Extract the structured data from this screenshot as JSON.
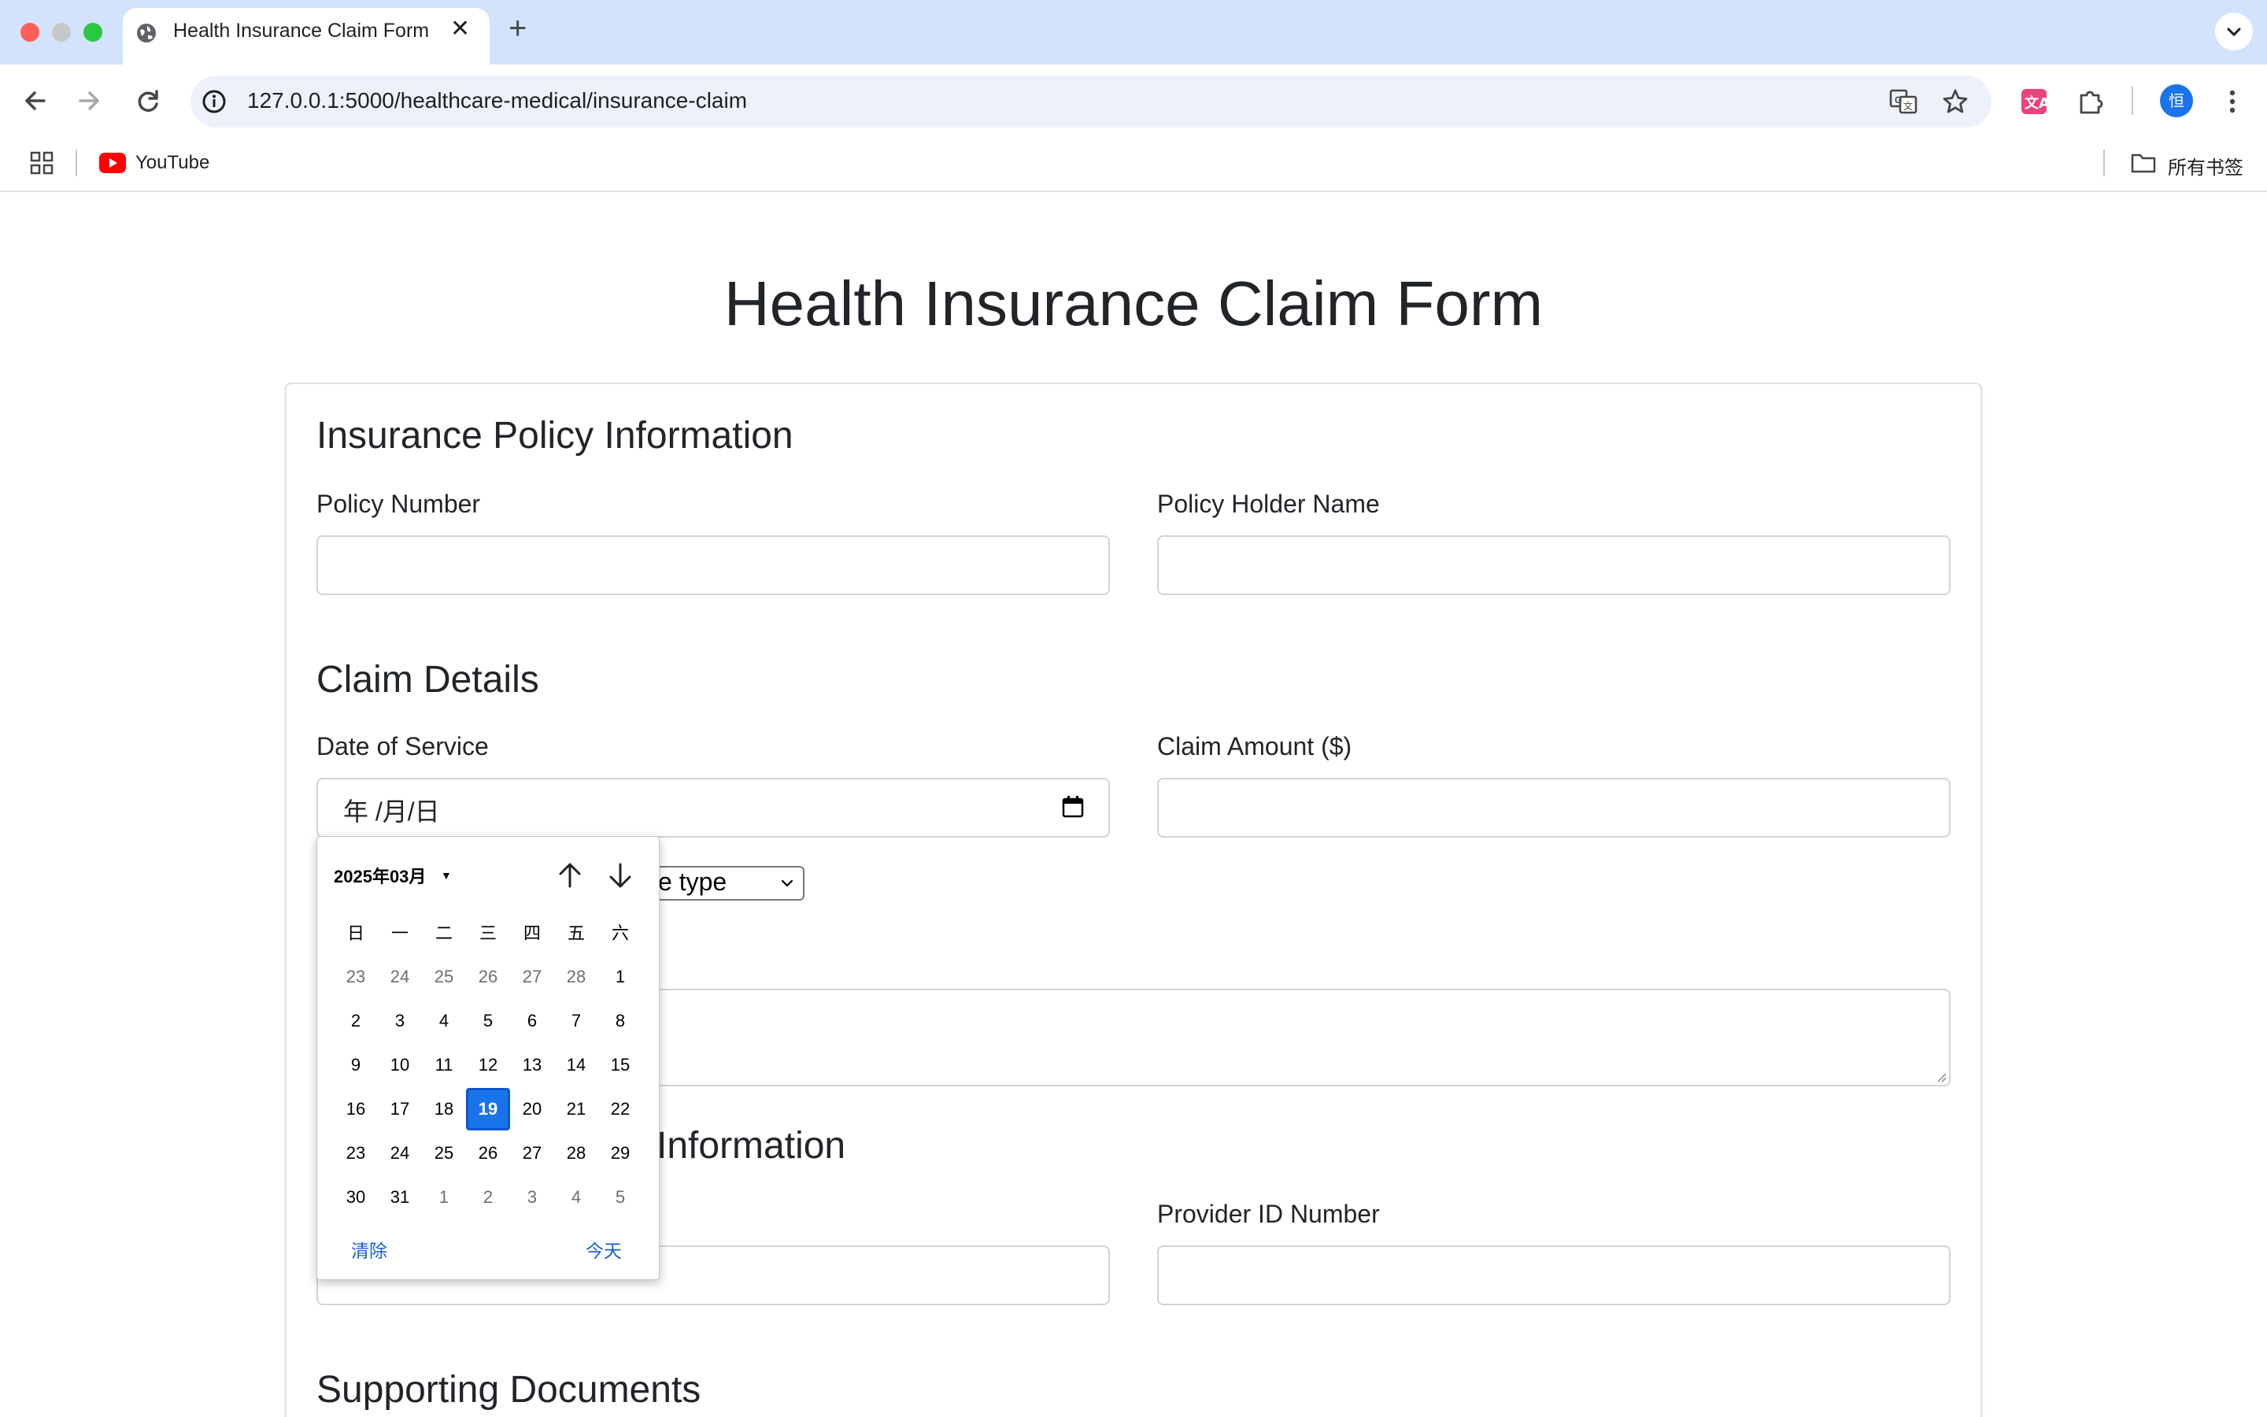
{
  "browser": {
    "tab_title": "Health Insurance Claim Form",
    "url": "127.0.0.1:5000/healthcare-medical/insurance-claim",
    "bookmark_youtube": "YouTube",
    "bookmark_folder": "所有书签",
    "profile_initial": "恒"
  },
  "page": {
    "title": "Health Insurance Claim Form"
  },
  "policy": {
    "heading": "Insurance Policy Information",
    "policy_number_label": "Policy Number",
    "policy_number_value": "",
    "holder_name_label": "Policy Holder Name",
    "holder_name_value": ""
  },
  "claim": {
    "heading": "Claim Details",
    "date_label": "Date of Service",
    "date_value": "年 /月/日",
    "amount_label": "Claim Amount ($)",
    "amount_value": "",
    "service_type_partial": "e type",
    "description_value": ""
  },
  "provider": {
    "heading_partial": "Information",
    "provider_id_label": "Provider ID Number",
    "provider_id_value": ""
  },
  "documents": {
    "heading": "Supporting Documents"
  },
  "datepicker": {
    "month_label": "2025年03月",
    "weekdays": [
      "日",
      "一",
      "二",
      "三",
      "四",
      "五",
      "六"
    ],
    "weeks": [
      [
        "23",
        "24",
        "25",
        "26",
        "27",
        "28",
        "1"
      ],
      [
        "2",
        "3",
        "4",
        "5",
        "6",
        "7",
        "8"
      ],
      [
        "9",
        "10",
        "11",
        "12",
        "13",
        "14",
        "15"
      ],
      [
        "16",
        "17",
        "18",
        "19",
        "20",
        "21",
        "22"
      ],
      [
        "23",
        "24",
        "25",
        "26",
        "27",
        "28",
        "29"
      ],
      [
        "30",
        "31",
        "1",
        "2",
        "3",
        "4",
        "5"
      ]
    ],
    "selected_day": "19",
    "clear_label": "清除",
    "today_label": "今天"
  },
  "colors": {
    "tabstrip": "#d3e3fd",
    "accent": "#1a73e8",
    "text": "#212529",
    "border": "#ced4da"
  }
}
